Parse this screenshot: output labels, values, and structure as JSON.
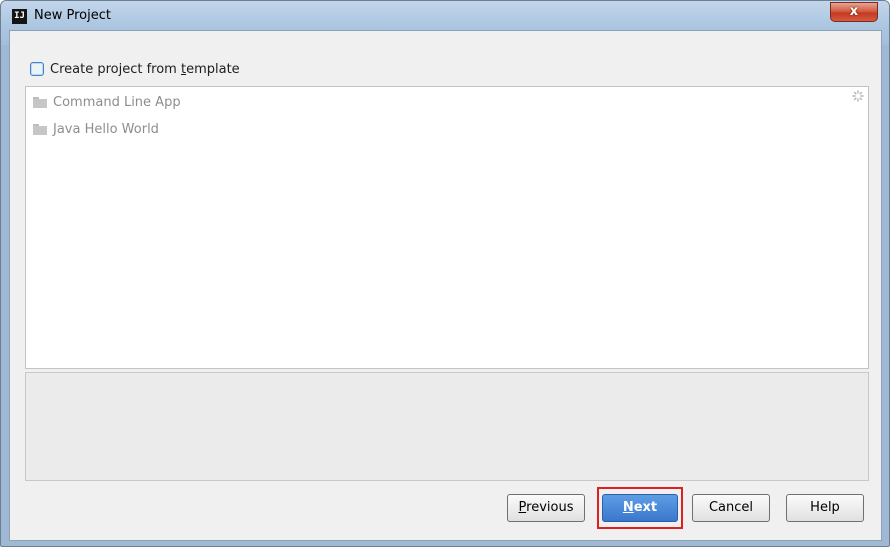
{
  "window": {
    "title": "New Project",
    "app_icon_text": "IJ",
    "close_label": "x"
  },
  "template": {
    "prefix": "Create project from ",
    "underlined": "t",
    "suffix": "emplate",
    "checked": false
  },
  "templates": {
    "items": [
      {
        "label": "Command Line App",
        "icon": "folder-icon"
      },
      {
        "label": "Java Hello World",
        "icon": "folder-icon"
      }
    ],
    "loading_icon": "spinner-icon"
  },
  "buttons": {
    "previous": {
      "mnemonic": "P",
      "rest": "revious"
    },
    "next": {
      "mnemonic": "N",
      "rest": "ext"
    },
    "cancel": {
      "label": "Cancel"
    },
    "help": {
      "label": "Help"
    }
  },
  "colors": {
    "highlight": "#e02020",
    "next_button": "#3a78cd",
    "close_button": "#c33a21"
  }
}
